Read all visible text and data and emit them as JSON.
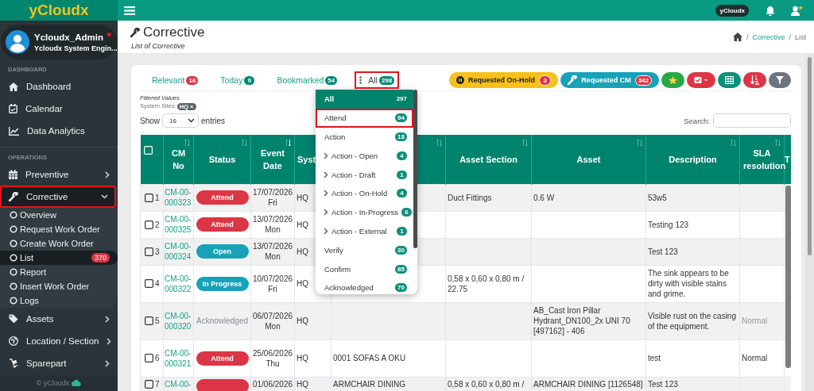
{
  "sidebar": {
    "logo": "yCloudx",
    "user": {
      "name": "Ycloudx_Admin",
      "online": true,
      "role": "Ycloudx System Engin..."
    },
    "sections": [
      {
        "title": "DASHBOARD",
        "items": [
          {
            "label": "Dashboard"
          },
          {
            "label": "Calendar"
          },
          {
            "label": "Data Analytics"
          }
        ]
      },
      {
        "title": "OPERATIONS",
        "items": [
          {
            "label": "Preventive",
            "expanded": false
          },
          {
            "label": "Corrective",
            "expanded": true,
            "highlighted": true,
            "children": [
              {
                "label": "Overview",
                "selected": false
              },
              {
                "label": "Request Work Order",
                "selected": false
              },
              {
                "label": "Create Work Order",
                "selected": false
              },
              {
                "label": "List",
                "selected": true,
                "badge": "370"
              },
              {
                "label": "Report",
                "selected": false
              },
              {
                "label": "Insert Work Order",
                "selected": false
              },
              {
                "label": "Logs",
                "selected": false
              }
            ]
          },
          {
            "label": "Assets",
            "expanded": false
          },
          {
            "label": "Location / Section",
            "expanded": false
          },
          {
            "label": "Sparepart",
            "expanded": false
          }
        ]
      }
    ],
    "footer": "© yCloudx"
  },
  "topbar": {
    "account": "yCloudx"
  },
  "page_header": {
    "title": "Corrective",
    "subtitle": "List of Corrective",
    "breadcrumb": [
      "Corrective",
      "List"
    ],
    "separators": [
      "/",
      "/"
    ]
  },
  "tabs": [
    {
      "label": "Relevant",
      "count": "16",
      "color": "#dc3545",
      "selected": false,
      "highlighted": false
    },
    {
      "label": "Today",
      "count": "0",
      "color": "#00897b",
      "selected": false,
      "highlighted": false
    },
    {
      "label": "Bookmarked",
      "count": "54",
      "color": "#00897b",
      "selected": false,
      "highlighted": false
    },
    {
      "label": "All",
      "count": "298",
      "color": "#00897b",
      "selected": true,
      "highlighted": true
    }
  ],
  "actions": [
    {
      "kind": "onhold",
      "label": "Requested On-Hold",
      "count": "3"
    },
    {
      "kind": "cm",
      "label": "Requested CM",
      "count": "342"
    },
    {
      "kind": "star"
    },
    {
      "kind": "checklist"
    },
    {
      "kind": "grid"
    },
    {
      "kind": "sort"
    },
    {
      "kind": "filter"
    }
  ],
  "filters": {
    "title": "Filtered Values",
    "label": "System Sites:",
    "chips": [
      {
        "text": "HQ",
        "remove": "×"
      }
    ]
  },
  "length_menu": {
    "before": "Show",
    "value": "16",
    "after": "entries"
  },
  "search": {
    "label": "Search:"
  },
  "table": {
    "all_checked": false,
    "columns": [
      {
        "label": "CM No",
        "sorted": false
      },
      {
        "label": "Status",
        "sorted": false
      },
      {
        "label": "Event Date",
        "sorted": true
      },
      {
        "label": "Syst"
      },
      {
        "sorted": false
      },
      {
        "label": "Asset Section",
        "sorted": false
      },
      {
        "label": "Asset",
        "sorted": false
      },
      {
        "label": "Description",
        "sorted": false
      },
      {
        "label": "SLA resolution",
        "sorted": false
      },
      {
        "label": "T"
      }
    ],
    "rows": [
      {
        "no": "1",
        "checked": false,
        "cm_no": "CM-00-000323",
        "status": {
          "kind": "attend",
          "text": "Attend"
        },
        "event_date": "17/07/2026",
        "event_day": "Fri",
        "site": "HQ",
        "asset_section": "Duct Fittings",
        "asset": "0.6 W",
        "description": "53w5"
      },
      {
        "no": "2",
        "checked": false,
        "cm_no": "CM-00-000325",
        "status": {
          "kind": "attend",
          "text": "Attend"
        },
        "event_date": "13/07/2026",
        "event_day": "Mon",
        "site": "HQ",
        "description": "Testing 123"
      },
      {
        "no": "3",
        "checked": false,
        "cm_no": "CM-00-000324",
        "status": {
          "kind": "open",
          "text": "Open"
        },
        "event_date": "13/07/2026",
        "event_day": "Mon",
        "site": "HQ",
        "description": "Test 123"
      },
      {
        "no": "4",
        "checked": false,
        "cm_no": "CM-00-000322",
        "status": {
          "kind": "progress",
          "text": "In Progress"
        },
        "event_date": "10/07/2026",
        "event_day": "Fri",
        "site": "HQ",
        "asset_section": "0,58 x 0,60 x 0,80 m / 22.75",
        "description": "The sink appears to be dirty with visible stains and grime."
      },
      {
        "no": "5",
        "checked": false,
        "cm_no": "CM-00-000320",
        "status": {
          "kind": "acknowledged",
          "text": "Acknowledged"
        },
        "event_date": "06/07/2026",
        "event_day": "Mon",
        "site": "HQ",
        "asset": "AB_Cast Iron Pillar Hydrant_DN100_2x UNI 70 [497162] - 406",
        "description": "Visible rust on the casing of the equipment.",
        "sla": {
          "text": "Normal",
          "muted": true
        }
      },
      {
        "no": "6",
        "checked": false,
        "cm_no": "CM-00-000321",
        "status": {
          "kind": "attend",
          "text": "Attend"
        },
        "event_date": "25/06/2026",
        "event_day": "Thu",
        "site": "HQ",
        "column_5": "0001 SOFAS A OKU",
        "description": "test",
        "sla": {
          "text": "Normal",
          "muted": false
        }
      },
      {
        "no": "7",
        "checked": false,
        "cm_no": "CM-00-",
        "status": {
          "kind": "attend"
        },
        "event_date": "01/06/2026",
        "site": "HQ",
        "column_5": "ARMCHAIR DINING",
        "asset_section": "0,58 x 0,60 x 0,80 m /",
        "asset": "ARMCHAIR DINING [1126548]",
        "description": "Test 123"
      }
    ]
  },
  "status_menu": [
    {
      "kind": "status",
      "label": "All",
      "count": "297",
      "selected": true,
      "highlighted": false
    },
    {
      "kind": "status",
      "label": "Attend",
      "count": "94",
      "selected": false,
      "highlighted": true
    },
    {
      "kind": "status",
      "label": "Action",
      "count": "18",
      "selected": false,
      "highlighted": false
    },
    {
      "kind": "sub",
      "label": "Action - Open",
      "count": "4",
      "selected": false,
      "highlighted": false
    },
    {
      "kind": "sub",
      "label": "Action - Draft",
      "count": "1",
      "selected": false,
      "highlighted": false
    },
    {
      "kind": "sub",
      "label": "Action - On-Hold",
      "count": "4",
      "selected": false,
      "highlighted": false
    },
    {
      "kind": "sub",
      "label": "Action - In-Progress",
      "count": "6",
      "selected": false,
      "highlighted": false
    },
    {
      "kind": "sub",
      "label": "Action - External",
      "count": "1",
      "selected": false,
      "highlighted": false
    },
    {
      "kind": "status",
      "label": "Verify",
      "count": "30",
      "selected": false,
      "highlighted": false
    },
    {
      "kind": "status",
      "label": "Confirm",
      "count": "85",
      "selected": false,
      "highlighted": false
    },
    {
      "kind": "status",
      "label": "Acknowledged",
      "count": "70",
      "selected": false,
      "highlighted": false
    }
  ]
}
